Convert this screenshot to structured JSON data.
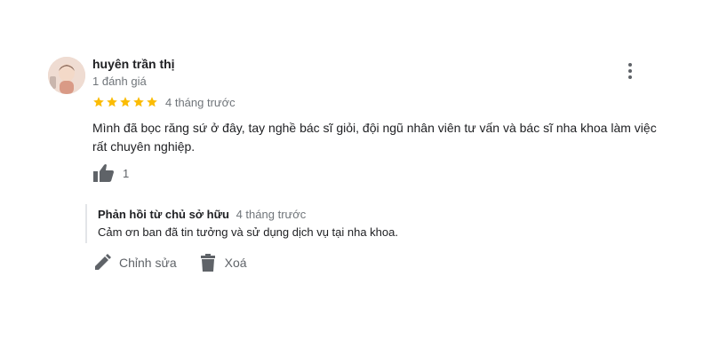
{
  "review": {
    "author_name": "huyên trần thị",
    "review_count": "1 đánh giá",
    "rating": 5,
    "rating_max": 5,
    "time_ago": "4 tháng trước",
    "text": "Mình đã bọc răng sứ ở đây, tay nghề bác sĩ giỏi, đội ngũ nhân viên tư vấn và bác sĩ nha khoa làm việc rất chuyên nghiệp.",
    "likes": "1",
    "icons": {
      "avatar": "profile-photo",
      "menu": "more-vert-icon",
      "like": "thumb-up-icon",
      "star": "star-icon"
    },
    "colors": {
      "star": "#fbbc04",
      "secondary_text": "#70757a",
      "icon": "#5f6368"
    }
  },
  "owner_reply": {
    "label": "Phản hồi từ chủ sở hữu",
    "time_ago": "4 tháng trước",
    "text": "Cảm ơn ban đã tin tưởng và sử dụng dịch vụ tại nha khoa."
  },
  "actions": {
    "edit_label": "Chỉnh sửa",
    "delete_label": "Xoá",
    "icons": {
      "edit": "pencil-icon",
      "delete": "trash-icon"
    }
  }
}
